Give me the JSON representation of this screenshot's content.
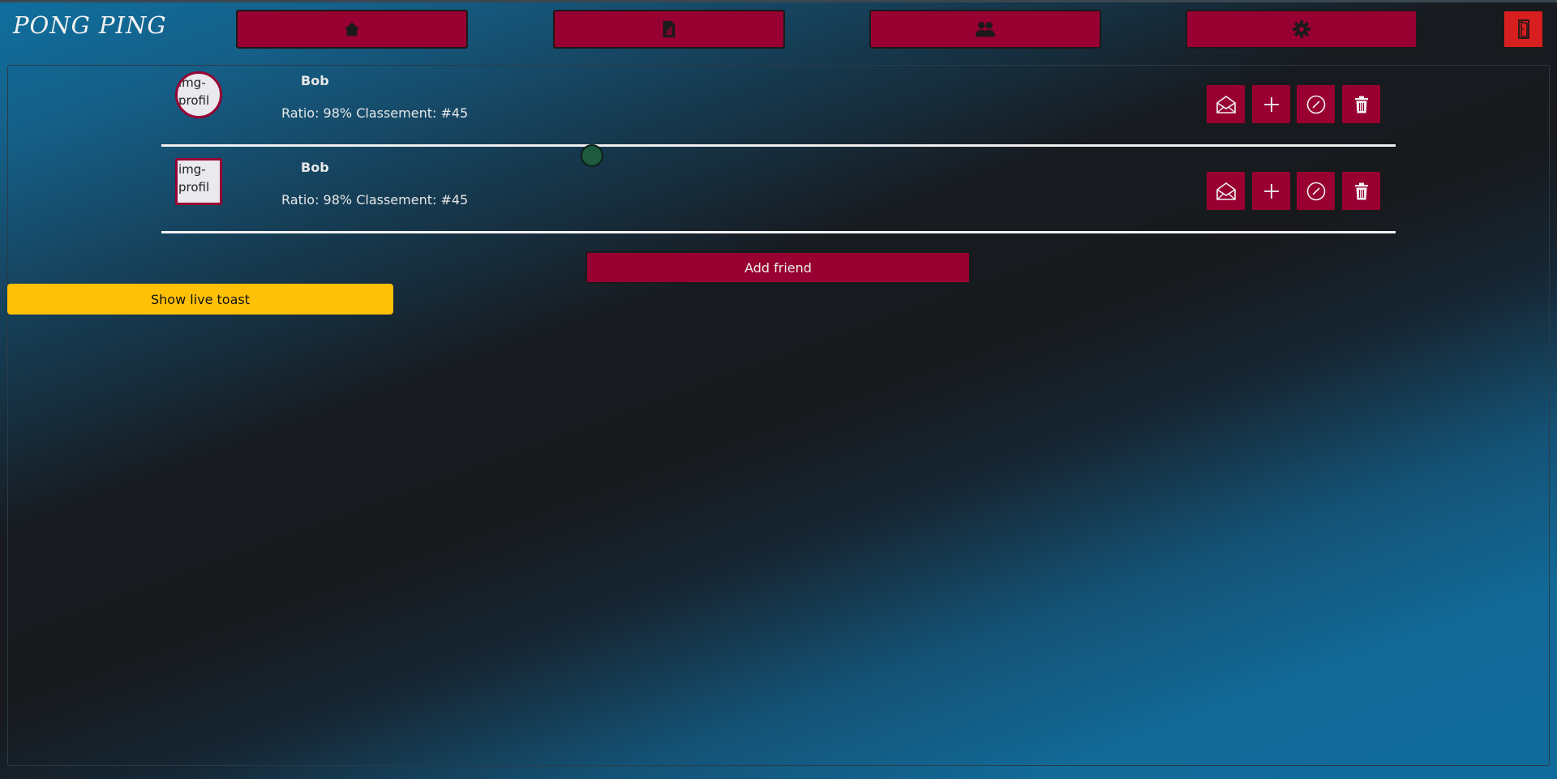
{
  "app": {
    "logo": "PONG PING"
  },
  "nav": {
    "items": [
      {
        "icon": "home-icon"
      },
      {
        "icon": "stats-icon"
      },
      {
        "icon": "friends-icon"
      },
      {
        "icon": "gear-icon"
      }
    ],
    "logout_icon": "door-icon"
  },
  "friends": [
    {
      "avatar_alt": "img-profil",
      "name": "Bob",
      "stats": "Ratio: 98% Classement: #45",
      "actions": [
        "envelope-icon",
        "plus-icon",
        "block-icon",
        "trash-icon"
      ]
    },
    {
      "avatar_alt": "img-profil",
      "name": "Bob",
      "stats": "Ratio: 98% Classement: #45",
      "actions": [
        "envelope-icon",
        "plus-icon",
        "block-icon",
        "trash-icon"
      ]
    }
  ],
  "add_friend_label": "Add friend",
  "toast_label": "Show live toast",
  "colors": {
    "primary": "#980032",
    "logout": "#d71f1f",
    "toast": "#ffc107",
    "status_online": "#1d5a3e"
  }
}
